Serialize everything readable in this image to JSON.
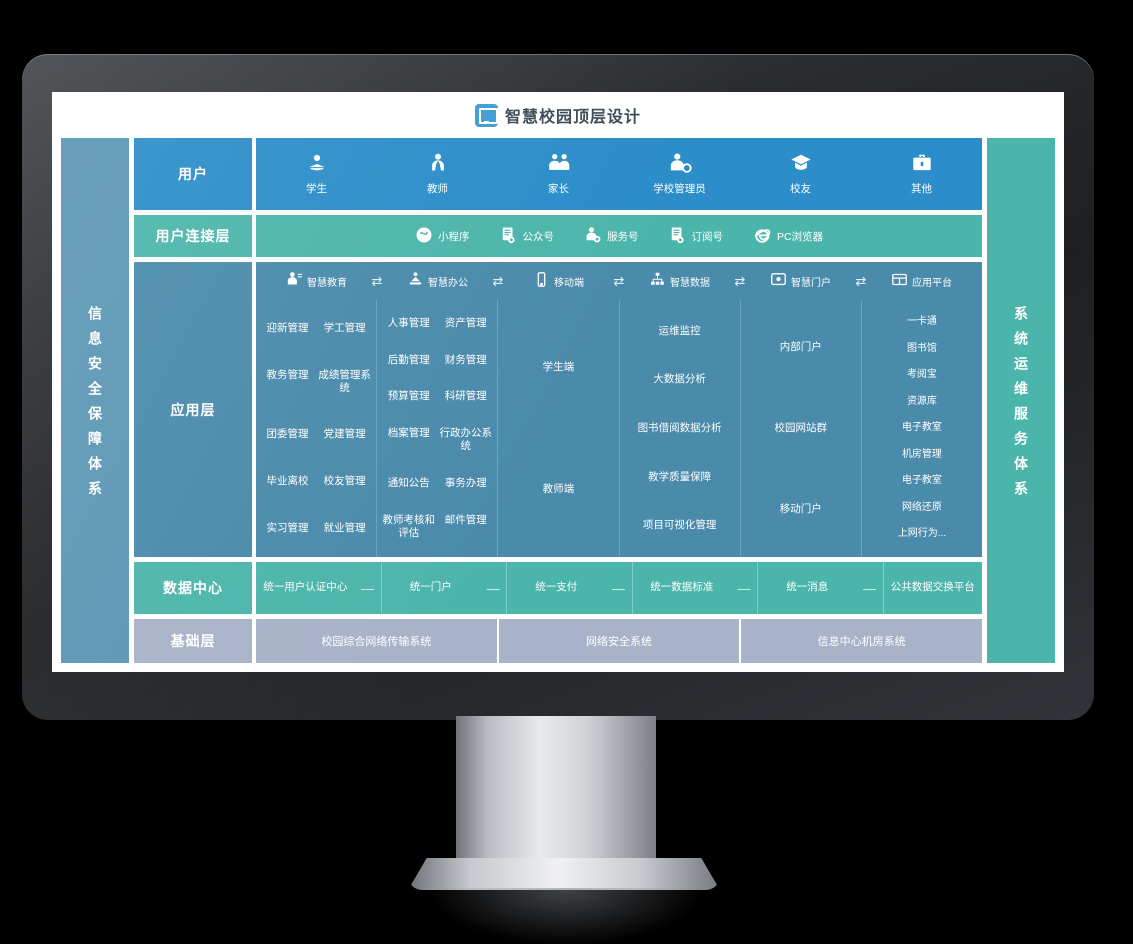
{
  "header": {
    "title": "智慧校园顶层设计",
    "icon": "monitor-icon",
    "accent": "#3f9ed4"
  },
  "sides": {
    "left": {
      "label": "信息安全保障体系",
      "color": "#5b96b4"
    },
    "right": {
      "label": "系统运维服务体系",
      "color": "#4cb5ab"
    }
  },
  "rows": {
    "user": {
      "label": "用户",
      "color": "#2b8dc9",
      "cells": [
        {
          "label": "学生",
          "icon": "student-icon",
          "glyph": "☰"
        },
        {
          "label": "教师",
          "icon": "teacher-icon",
          "glyph": "☰"
        },
        {
          "label": "家长",
          "icon": "parents-icon",
          "glyph": "☰"
        },
        {
          "label": "学校管理员",
          "icon": "admin-gear-icon",
          "glyph": "☰"
        },
        {
          "label": "校友",
          "icon": "graduate-cap-icon",
          "glyph": "☰"
        },
        {
          "label": "其他",
          "icon": "briefcase-icon",
          "glyph": "☰"
        }
      ]
    },
    "connect": {
      "label": "用户连接层",
      "color": "#4cb5ab",
      "cells": [
        {
          "label": "小程序",
          "icon": "mini-program-icon"
        },
        {
          "label": "公众号",
          "icon": "official-account-icon"
        },
        {
          "label": "服务号",
          "icon": "service-account-icon"
        },
        {
          "label": "订阅号",
          "icon": "subscription-account-icon"
        },
        {
          "label": "PC浏览器",
          "icon": "ie-browser-icon"
        }
      ]
    },
    "app": {
      "label": "应用层",
      "color": "#4a8aab",
      "arrow": "⇄",
      "columns": [
        {
          "head": "智慧教育",
          "icon": "smart-education-icon",
          "layout": "2x",
          "items": [
            "迎新管理",
            "学工管理",
            "教务管理",
            "成绩管理系统",
            "团委管理",
            "党建管理",
            "毕业离校",
            "校友管理",
            "实习管理",
            "就业管理"
          ]
        },
        {
          "head": "智慧办公",
          "icon": "smart-office-icon",
          "layout": "2x",
          "items": [
            "人事管理",
            "资产管理",
            "后勤管理",
            "财务管理",
            "预算管理",
            "科研管理",
            "档案管理",
            "行政办公系统",
            "通知公告",
            "事务办理",
            "教师考核和评估",
            "邮件管理"
          ]
        },
        {
          "head": "移动端",
          "icon": "mobile-icon",
          "layout": "1x",
          "items": [
            "学生端",
            "教师端"
          ]
        },
        {
          "head": "智慧数据",
          "icon": "smart-data-icon",
          "layout": "1x",
          "items": [
            "运维监控",
            "大数据分析",
            "图书借阅数据分析",
            "教学质量保障",
            "项目可视化管理"
          ]
        },
        {
          "head": "智慧门户",
          "icon": "smart-portal-icon",
          "layout": "1x",
          "items": [
            "内部门户",
            "校园网站群",
            "移动门户"
          ]
        },
        {
          "head": "应用平台",
          "icon": "app-platform-icon",
          "layout": "tight",
          "items": [
            "一卡通",
            "图书馆",
            "考阅宝",
            "资源库",
            "电子教室",
            "机房管理",
            "电子教室",
            "网络还原",
            "上网行为..."
          ]
        }
      ]
    },
    "data": {
      "label": "数据中心",
      "color": "#4cb5ab",
      "separator": "—",
      "cells": [
        "统一用户认证中心",
        "统一门户",
        "统一支付",
        "统一数据标准",
        "统一消息",
        "公共数据交换平台"
      ]
    },
    "base": {
      "label": "基础层",
      "color": "#a8b2c8",
      "cells": [
        "校园综合网络传输系统",
        "网络安全系统",
        "信息中心机房系统"
      ]
    }
  }
}
